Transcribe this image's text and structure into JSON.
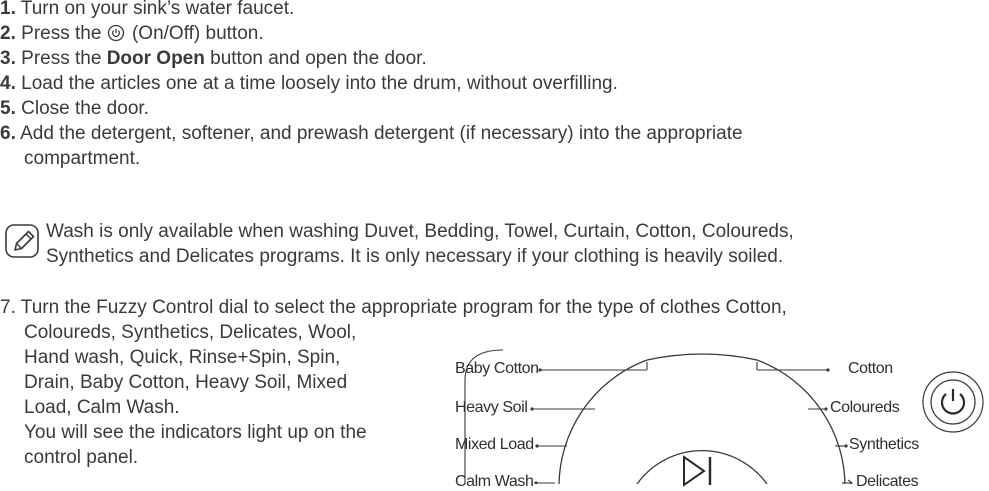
{
  "steps": [
    {
      "num": "1.",
      "text": "Turn on your sink’s water faucet."
    },
    {
      "num": "2.",
      "before": "Press the",
      "after": "(On/Off) button."
    },
    {
      "num": "3.",
      "before": "Press the ",
      "bold": "Door Open",
      "after": " button and open the door."
    },
    {
      "num": "4.",
      "text": "Load the articles one at a time loosely into the drum, without overfilling."
    },
    {
      "num": "5.",
      "text": "Close the door."
    },
    {
      "num": "6.",
      "line1": "Add the detergent, softener, and prewash detergent (if necessary) into the appropriate",
      "line2": "compartment."
    }
  ],
  "note": {
    "line1": "Wash is only available when washing Duvet, Bedding, Towel, Curtain, Cotton, Coloureds,",
    "line2": "Synthetics and Delicates programs. It is only necessary if your clothing is heavily soiled."
  },
  "step7": {
    "num": "7.",
    "line1": "Turn the Fuzzy Control dial to select the appropriate program for the type of clothes Cotton,",
    "line2": "Coloureds, Synthetics, Delicates, Wool,",
    "line3": "Hand wash, Quick, Rinse+Spin, Spin,",
    "line4": "Drain, Baby Cotton, Heavy Soil, Mixed",
    "line5": "Load, Calm Wash.",
    "line6": "You will see the indicators light up on the",
    "line7": "control panel."
  },
  "dial_labels": {
    "left": [
      "Baby Cotton",
      "Heavy Soil",
      "Mixed Load",
      "Calm Wash"
    ],
    "right": [
      "Cotton",
      "Coloureds",
      "Synthetics",
      "Delicates"
    ]
  },
  "icons": {
    "note": "note-pencil-icon",
    "power": "power-icon",
    "play_pause": "play-pause-icon"
  }
}
